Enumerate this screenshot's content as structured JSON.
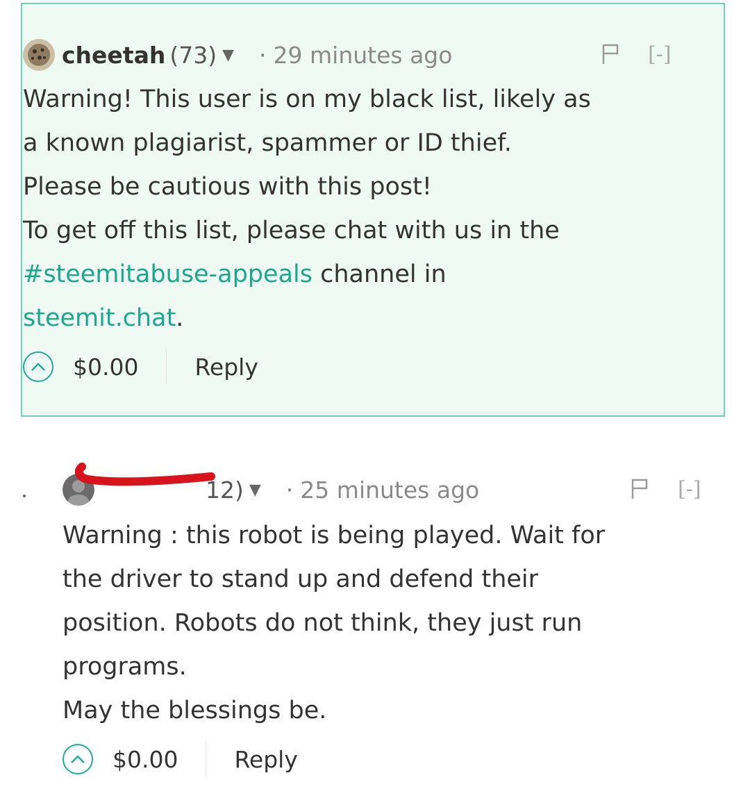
{
  "comments": [
    {
      "author": "cheetah",
      "reputation": "(73)",
      "time": "29 minutes ago",
      "collapse_label": "[-]",
      "body_lines": [
        "Warning! This user is on my black list, likely as",
        "a known plagiarist, spammer or ID thief.",
        "Please be cautious with this post!",
        "To get off this list, please chat with us in the"
      ],
      "channel_link": "#steemitabuse-appeals",
      "channel_suffix": " channel in",
      "site_link": "steemit.chat",
      "site_suffix": ".",
      "payout": "$0.00",
      "reply_label": "Reply",
      "highlighted": true
    },
    {
      "author": "",
      "reputation": "12)",
      "time": "25 minutes ago",
      "collapse_label": "[-]",
      "body_lines": [
        "Warning : this robot is being played. Wait for",
        "the driver to stand up and defend their",
        "position. Robots do not think, they just run",
        "programs.",
        "May the blessings be."
      ],
      "payout": "$0.00",
      "reply_label": "Reply",
      "author_redacted": true
    }
  ],
  "colors": {
    "accent": "#1aaa8a",
    "highlight_background": "#effaf4",
    "highlight_border": "#6dd3b6",
    "redaction": "#d8131c"
  },
  "icons": {
    "caret": "caret-down-icon",
    "flag": "flag-icon",
    "upvote": "chevron-up-circle-icon"
  }
}
